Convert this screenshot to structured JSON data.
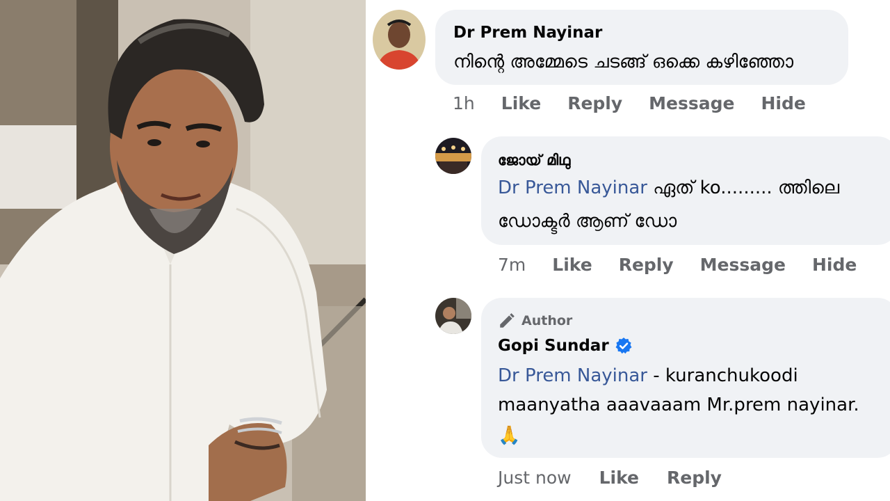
{
  "comments": [
    {
      "name": "Dr Prem Nayinar",
      "text": "നിന്റെ അമ്മേടെ ചടങ്ങ് ഒക്കെ കഴിഞ്ഞോ",
      "time": "1h",
      "actions": [
        "Like",
        "Reply",
        "Message",
        "Hide"
      ]
    },
    {
      "name": "ജോയ് മിഥു",
      "mention": "Dr Prem Nayinar",
      "text_line1": " ഏത് ko......... ത്തിലെ",
      "text_line2": "ഡോക്ടർ ആണ് ഡോ",
      "time": "7m",
      "actions": [
        "Like",
        "Reply",
        "Message",
        "Hide"
      ]
    },
    {
      "author_tag": "Author",
      "name": "Gopi Sundar",
      "mention": "Dr Prem Nayinar",
      "text_line1": " - kuranchukoodi",
      "text_line2": "maanyatha aaavaaam Mr.prem nayinar.",
      "text_line3": "🙏",
      "time": "Just now",
      "actions": [
        "Like",
        "Reply"
      ]
    }
  ],
  "icons": {
    "verified": "verified-badge-icon",
    "author": "pencil-icon"
  },
  "colors": {
    "bubble": "#f0f2f5",
    "mention": "#385898",
    "meta": "#65676b",
    "verified": "#1877f2"
  }
}
